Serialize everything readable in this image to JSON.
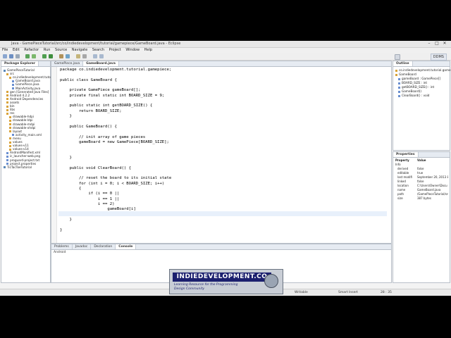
{
  "window": {
    "title": "Java - GamePieceTutorial/src/co/indiedevelopment/tutorial/gamepiece/GameBoard.java - Eclipse"
  },
  "menu": [
    "File",
    "Edit",
    "Refactor",
    "Run",
    "Source",
    "Navigate",
    "Search",
    "Project",
    "Window",
    "Help"
  ],
  "perspective": "DDMS",
  "package_explorer": {
    "tab": "Package Explorer",
    "items": [
      "GamePieceTutorial",
      "src",
      "co.indiedevelopment.tutorial.g",
      "GameBoard.java",
      "GamePiece.java",
      "MainActivity.java",
      "gen [Generated Java Files]",
      "Android 4.2.2",
      "Android Dependencies",
      "assets",
      "bin",
      "libs",
      "res",
      "drawable-hdpi",
      "drawable-ldpi",
      "drawable-mdpi",
      "drawable-xhdpi",
      "layout",
      "activity_main.xml",
      "menu",
      "values",
      "values-v11",
      "values-v14",
      "AndroidManifest.xml",
      "ic_launcher-web.png",
      "proguard-project.txt",
      "project.properties",
      "TicTacToeTutorial"
    ]
  },
  "editor": {
    "tabs": [
      "GamePiece.java",
      "GameBoard.java"
    ],
    "active_tab": "GameBoard.java",
    "code": [
      "package co.indiedevelopment.tutorial.gamepiece;",
      "",
      "public class GameBoard {",
      "",
      "    private GamePiece gameBoard[];",
      "    private final static int BOARD_SIZE = 9;",
      "",
      "    public static int getBOARD_SIZE() {",
      "        return BOARD_SIZE;",
      "    }",
      "",
      "    public GameBoard() {",
      "",
      "        // init array of game pieces",
      "        gameBoard = new GamePiece[BOARD_SIZE];",
      "",
      "",
      "    }",
      "",
      "    public void ClearBoard() {",
      "",
      "        // reset the board to its initial state",
      "        for (int i = 0; i < BOARD_SIZE; i++)",
      "        {",
      "            if (i == 0 ||",
      "                i == 1 ||",
      "                i == 2)",
      "                    gameBoard[i]",
      "        }",
      "    }",
      "",
      "}"
    ]
  },
  "outline": {
    "tab": "Outline",
    "items": [
      "co.indiedevelopment.tutorial.gamepi",
      "GameBoard",
      "gameBoard : GamePiece[]",
      "BOARD_SIZE : int",
      "getBOARD_SIZE() : int",
      "GameBoard()",
      "ClearBoard() : void"
    ]
  },
  "properties": {
    "tab": "Properties",
    "headers": [
      "Property",
      "Value"
    ],
    "group": "Info",
    "rows": [
      [
        "derived",
        "false"
      ],
      [
        "editable",
        "true"
      ],
      [
        "last modifi",
        "September 20, 2013 8:5"
      ],
      [
        "linked",
        "false"
      ],
      [
        "location",
        "C:\\Users\\Owner\\Docu"
      ],
      [
        "name",
        "GameBoard.java"
      ],
      [
        "path",
        "/GamePieceTutorial/src"
      ],
      [
        "size",
        "387 bytes"
      ]
    ]
  },
  "bottom_panel": {
    "tabs": [
      "Problems",
      "Javadoc",
      "Declaration",
      "Console"
    ],
    "active_tab": "Console",
    "console_text": "Android"
  },
  "status": {
    "writable": "Writable",
    "insert_mode": "Smart Insert",
    "position": "28 : 35"
  },
  "watermark": {
    "title": "INDIEDEVELOPMENT.CO",
    "tagline1": "Learning Resource for the Programming",
    "tagline2": "Design Community"
  }
}
